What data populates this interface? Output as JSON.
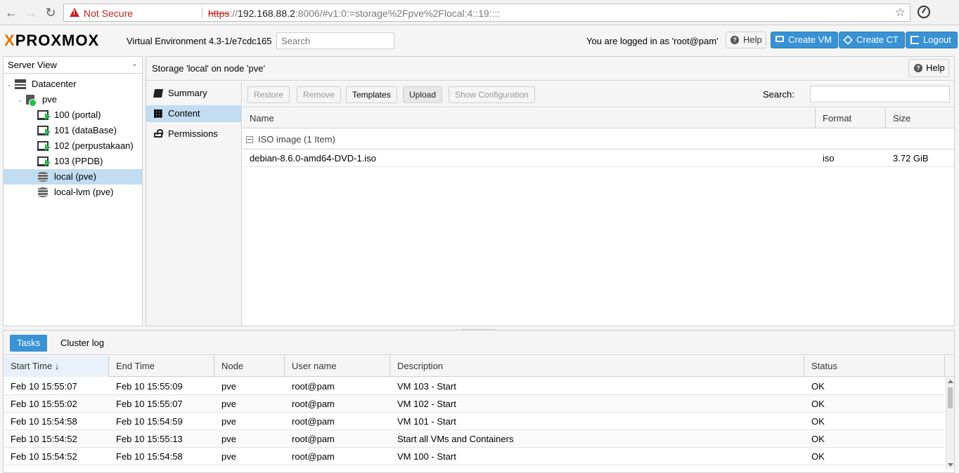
{
  "browser": {
    "security_label": "Not Secure",
    "url_scheme": "https",
    "url_host": "192.168.88.2",
    "url_rest": ":8006/#v1:0:=storage%2Fpve%2Flocal:4::19::::"
  },
  "header": {
    "logo_x": "X",
    "logo_text": "PROXMOX",
    "version": "Virtual Environment 4.3-1/e7cdc165",
    "search_placeholder": "Search",
    "logged_in": "You are logged in as 'root@pam'",
    "help": "Help",
    "create_vm": "Create VM",
    "create_ct": "Create CT",
    "logout": "Logout"
  },
  "tree": {
    "view": "Server View",
    "datacenter": "Datacenter",
    "node": "pve",
    "items": [
      {
        "label": "100 (portal)",
        "type": "vm"
      },
      {
        "label": "101 (dataBase)",
        "type": "vm"
      },
      {
        "label": "102 (perpustakaan)",
        "type": "vm"
      },
      {
        "label": "103 (PPDB)",
        "type": "vm"
      },
      {
        "label": "local (pve)",
        "type": "storage",
        "selected": true
      },
      {
        "label": "local-lvm (pve)",
        "type": "storage"
      }
    ]
  },
  "main": {
    "title": "Storage 'local' on node 'pve'",
    "help": "Help",
    "nav": [
      {
        "label": "Summary",
        "icon": "book-icon"
      },
      {
        "label": "Content",
        "icon": "grid-icon",
        "selected": true
      },
      {
        "label": "Permissions",
        "icon": "unlock-icon"
      }
    ],
    "toolbar": {
      "restore": "Restore",
      "remove": "Remove",
      "templates": "Templates",
      "upload": "Upload",
      "show_config": "Show Configuration",
      "search_label": "Search:"
    },
    "columns": {
      "name": "Name",
      "format": "Format",
      "size": "Size"
    },
    "group": "ISO image (1 Item)",
    "rows": [
      {
        "name": "debian-8.6.0-amd64-DVD-1.iso",
        "format": "iso",
        "size": "3.72 GiB"
      }
    ]
  },
  "log": {
    "tabs": {
      "tasks": "Tasks",
      "cluster": "Cluster log"
    },
    "columns": {
      "start": "Start Time",
      "end": "End Time",
      "node": "Node",
      "user": "User name",
      "desc": "Description",
      "status": "Status"
    },
    "rows": [
      {
        "start": "Feb 10 15:55:07",
        "end": "Feb 10 15:55:09",
        "node": "pve",
        "user": "root@pam",
        "desc": "VM 103 - Start",
        "status": "OK"
      },
      {
        "start": "Feb 10 15:55:02",
        "end": "Feb 10 15:55:07",
        "node": "pve",
        "user": "root@pam",
        "desc": "VM 102 - Start",
        "status": "OK"
      },
      {
        "start": "Feb 10 15:54:58",
        "end": "Feb 10 15:54:59",
        "node": "pve",
        "user": "root@pam",
        "desc": "VM 101 - Start",
        "status": "OK"
      },
      {
        "start": "Feb 10 15:54:52",
        "end": "Feb 10 15:55:13",
        "node": "pve",
        "user": "root@pam",
        "desc": "Start all VMs and Containers",
        "status": "OK"
      },
      {
        "start": "Feb 10 15:54:52",
        "end": "Feb 10 15:54:58",
        "node": "pve",
        "user": "root@pam",
        "desc": "VM 100 - Start",
        "status": "OK"
      }
    ]
  },
  "colors": {
    "accent": "#3892d4",
    "selection": "#c2ddf2",
    "brand_orange": "#e57000",
    "running_green": "#21bf4b"
  }
}
